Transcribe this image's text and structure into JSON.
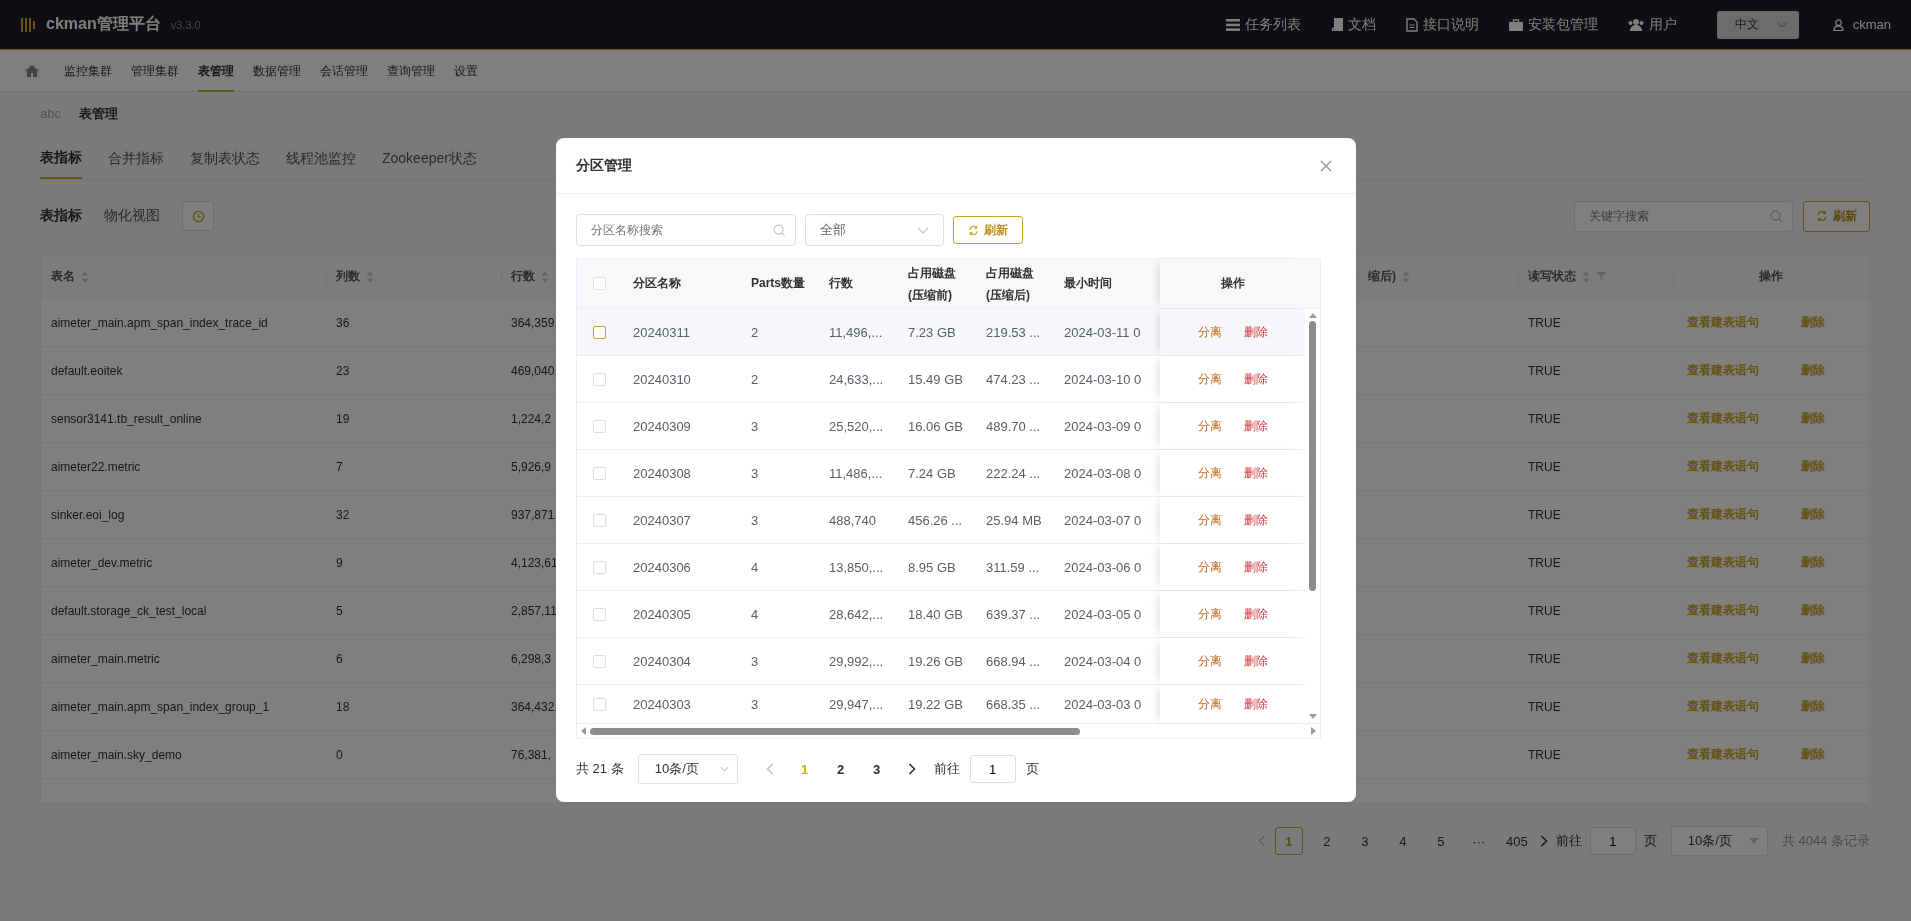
{
  "header": {
    "title": "ckman管理平台",
    "version": "v3.3.0",
    "nav": [
      {
        "label": "任务列表"
      },
      {
        "label": "文档"
      },
      {
        "label": "接口说明"
      },
      {
        "label": "安装包管理"
      },
      {
        "label": "用户"
      }
    ],
    "language": "中文",
    "user": "ckman"
  },
  "module_nav": [
    {
      "label": "监控集群",
      "selected": false
    },
    {
      "label": "管理集群",
      "selected": false
    },
    {
      "label": "表管理",
      "selected": true
    },
    {
      "label": "数据管理",
      "selected": false
    },
    {
      "label": "会话管理",
      "selected": false
    },
    {
      "label": "查询管理",
      "selected": false
    },
    {
      "label": "设置",
      "selected": false
    }
  ],
  "breadcrumb": [
    "abc",
    "表管理"
  ],
  "tabs": [
    {
      "label": "表指标",
      "selected": true
    },
    {
      "label": "合并指标",
      "selected": false
    },
    {
      "label": "复制表状态",
      "selected": false
    },
    {
      "label": "线程池监控",
      "selected": false
    },
    {
      "label": "Zookeeper状态",
      "selected": false
    }
  ],
  "sub_tabs": [
    {
      "label": "表指标",
      "selected": true
    },
    {
      "label": "物化视图",
      "selected": false
    }
  ],
  "search": {
    "placeholder": "关键字搜索"
  },
  "refresh_button": "刷新",
  "table": {
    "columns": [
      {
        "label": "表名",
        "sortable": true,
        "filterable": false
      },
      {
        "label": "列数",
        "sortable": true,
        "filterable": false
      },
      {
        "label": "行数",
        "sortable": true,
        "filterable": false
      },
      {
        "label": "缩后)",
        "sortable": true,
        "filterable": false
      },
      {
        "label": "读写状态",
        "sortable": true,
        "filterable": true
      },
      {
        "label": "操作",
        "sortable": false,
        "filterable": false
      }
    ],
    "rows": [
      {
        "name": "aimeter_main.apm_span_index_trace_id",
        "columns": "36",
        "rows": "364,359,",
        "status": "TRUE",
        "actions": [
          "查看建表语句",
          "删除"
        ]
      },
      {
        "name": "default.eoitek",
        "columns": "23",
        "rows": "469,040,",
        "status": "TRUE",
        "actions": [
          "查看建表语句",
          "删除"
        ]
      },
      {
        "name": "sensor3141.tb_result_online",
        "columns": "19",
        "rows": "1,224,2",
        "status": "TRUE",
        "actions": [
          "查看建表语句",
          "删除"
        ]
      },
      {
        "name": "aimeter22.metric",
        "columns": "7",
        "rows": "5,926,9",
        "status": "TRUE",
        "actions": [
          "查看建表语句",
          "删除"
        ]
      },
      {
        "name": "sinker.eoi_log",
        "columns": "32",
        "rows": "937,871,",
        "status": "TRUE",
        "actions": [
          "查看建表语句",
          "删除"
        ]
      },
      {
        "name": "aimeter_dev.metric",
        "columns": "9",
        "rows": "4,123,61",
        "status": "TRUE",
        "actions": [
          "查看建表语句",
          "删除"
        ]
      },
      {
        "name": "default.storage_ck_test_local",
        "columns": "5",
        "rows": "2,857,11",
        "status": "TRUE",
        "actions": [
          "查看建表语句",
          "删除"
        ]
      },
      {
        "name": "aimeter_main.metric",
        "columns": "6",
        "rows": "6,298,3",
        "status": "TRUE",
        "actions": [
          "查看建表语句",
          "删除"
        ]
      },
      {
        "name": "aimeter_main.apm_span_index_group_1",
        "columns": "18",
        "rows": "364,432,",
        "status": "TRUE",
        "actions": [
          "查看建表语句",
          "删除"
        ]
      },
      {
        "name": "aimeter_main.sky_demo",
        "columns": "0",
        "rows": "76,381,",
        "status": "TRUE",
        "actions": [
          "查看建表语句",
          "删除"
        ]
      }
    ]
  },
  "pagination": {
    "prev_disabled": true,
    "pages": [
      {
        "label": "1",
        "selected": true
      },
      {
        "label": "2",
        "selected": false
      },
      {
        "label": "3",
        "selected": false
      },
      {
        "label": "4",
        "selected": false
      },
      {
        "label": "5",
        "selected": false
      },
      {
        "label": "···",
        "selected": false
      },
      {
        "label": "405",
        "selected": false
      }
    ],
    "goto_label": "前往",
    "goto_value": "1",
    "goto_suffix": "页",
    "page_size": "10条/页",
    "total": "共 4044 条记录"
  },
  "dialog": {
    "title": "分区管理",
    "search": {
      "placeholder": "分区名称搜索"
    },
    "filter": {
      "value": "全部"
    },
    "refresh_button": "刷新",
    "table": {
      "all_checked": false,
      "columns": [
        {
          "label": "分区名称"
        },
        {
          "label": "Parts数量"
        },
        {
          "label": "行数"
        },
        {
          "label": "占用磁盘(压缩前)"
        },
        {
          "label": "占用磁盘(压缩后)"
        },
        {
          "label": "最小时间"
        },
        {
          "label": "操作"
        }
      ],
      "rows": [
        {
          "checked": false,
          "hovered": true,
          "partition": "20240311",
          "parts": "2",
          "rows": "11,496,...",
          "disk_before": "7.23 GB",
          "disk_after": "219.53 ...",
          "min_time": "2024-03-11 0",
          "actions": [
            "分离",
            "删除"
          ]
        },
        {
          "checked": false,
          "hovered": false,
          "partition": "20240310",
          "parts": "2",
          "rows": "24,633,...",
          "disk_before": "15.49 GB",
          "disk_after": "474.23 ...",
          "min_time": "2024-03-10 0",
          "actions": [
            "分离",
            "删除"
          ]
        },
        {
          "checked": false,
          "hovered": false,
          "partition": "20240309",
          "parts": "3",
          "rows": "25,520,...",
          "disk_before": "16.06 GB",
          "disk_after": "489.70 ...",
          "min_time": "2024-03-09 0",
          "actions": [
            "分离",
            "删除"
          ]
        },
        {
          "checked": false,
          "hovered": false,
          "partition": "20240308",
          "parts": "3",
          "rows": "11,486,...",
          "disk_before": "7.24 GB",
          "disk_after": "222.24 ...",
          "min_time": "2024-03-08 0",
          "actions": [
            "分离",
            "删除"
          ]
        },
        {
          "checked": false,
          "hovered": false,
          "partition": "20240307",
          "parts": "3",
          "rows": "488,740",
          "disk_before": "456.26 ...",
          "disk_after": "25.94 MB",
          "min_time": "2024-03-07 0",
          "actions": [
            "分离",
            "删除"
          ]
        },
        {
          "checked": false,
          "hovered": false,
          "partition": "20240306",
          "parts": "4",
          "rows": "13,850,...",
          "disk_before": "8.95 GB",
          "disk_after": "311.59 ...",
          "min_time": "2024-03-06 0",
          "actions": [
            "分离",
            "删除"
          ]
        },
        {
          "checked": false,
          "hovered": false,
          "partition": "20240305",
          "parts": "4",
          "rows": "28,642,...",
          "disk_before": "18.40 GB",
          "disk_after": "639.37 ...",
          "min_time": "2024-03-05 0",
          "actions": [
            "分离",
            "删除"
          ]
        },
        {
          "checked": false,
          "hovered": false,
          "partition": "20240304",
          "parts": "3",
          "rows": "29,992,...",
          "disk_before": "19.26 GB",
          "disk_after": "668.94 ...",
          "min_time": "2024-03-04 0",
          "actions": [
            "分离",
            "删除"
          ]
        },
        {
          "checked": false,
          "hovered": false,
          "partition": "20240303",
          "parts": "3",
          "rows": "29,947,...",
          "disk_before": "19.22 GB",
          "disk_after": "668.35 ...",
          "min_time": "2024-03-03 0",
          "actions": [
            "分离",
            "删除"
          ]
        }
      ]
    },
    "pagination": {
      "total": "共 21 条",
      "page_size": "10条/页",
      "prev_disabled": true,
      "pages": [
        {
          "label": "1",
          "selected": true
        },
        {
          "label": "2",
          "selected": false
        },
        {
          "label": "3",
          "selected": false
        }
      ],
      "goto_label": "前往",
      "goto_value": "1",
      "goto_suffix": "页"
    }
  }
}
